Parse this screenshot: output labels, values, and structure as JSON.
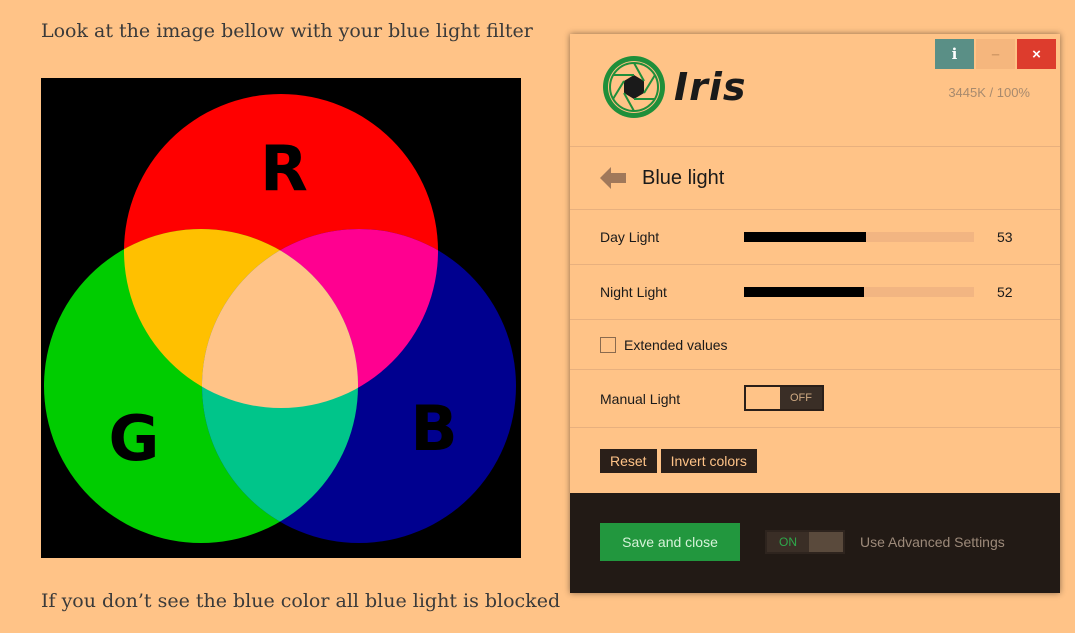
{
  "page": {
    "instruction_top": "Look at the image bellow with your blue light filter",
    "instruction_bottom": "If you don’t see the blue color all blue light is blocked",
    "rgb_labels": {
      "r": "R",
      "g": "G",
      "b": "B"
    },
    "colors": {
      "background": "#ffc387",
      "red": "#ff0000",
      "green": "#00cc00",
      "blue": "#00008f"
    }
  },
  "window": {
    "info_label": "i",
    "minimize_label": "–",
    "close_label": "×"
  },
  "app": {
    "name": "Iris",
    "temperature": "3445K / 100%",
    "accent_color": "#22973e"
  },
  "section": {
    "title": "Blue light"
  },
  "sliders": {
    "day": {
      "label": "Day Light",
      "value": "53",
      "fraction": 0.53
    },
    "night": {
      "label": "Night Light",
      "value": "52",
      "fraction": 0.52
    }
  },
  "extended": {
    "label": "Extended values",
    "checked": false
  },
  "manual": {
    "label": "Manual Light",
    "toggle_text": "OFF"
  },
  "buttons": {
    "reset": "Reset",
    "invert": "Invert colors"
  },
  "footer": {
    "save": "Save and close",
    "toggle_text": "ON",
    "advanced_label": "Use Advanced Settings"
  }
}
